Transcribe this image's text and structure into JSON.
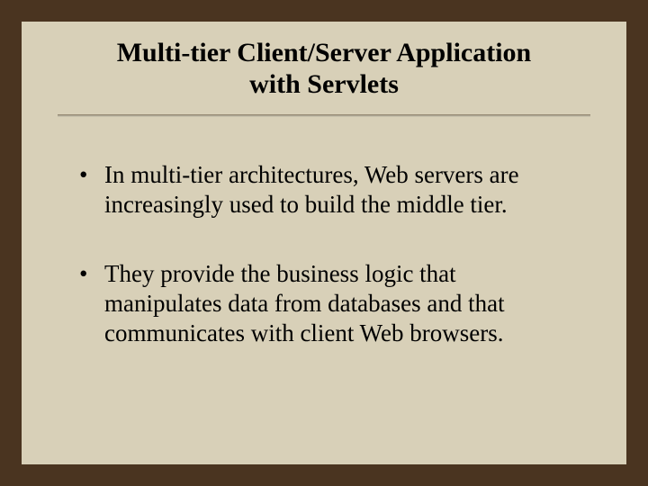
{
  "title_line1": "Multi-tier Client/Server Application",
  "title_line2": "with Servlets",
  "bullets": [
    "In multi-tier architectures, Web servers are increasingly used to build the middle tier.",
    "They provide the business logic that manipulates data from databases and that communicates with client Web browsers."
  ]
}
